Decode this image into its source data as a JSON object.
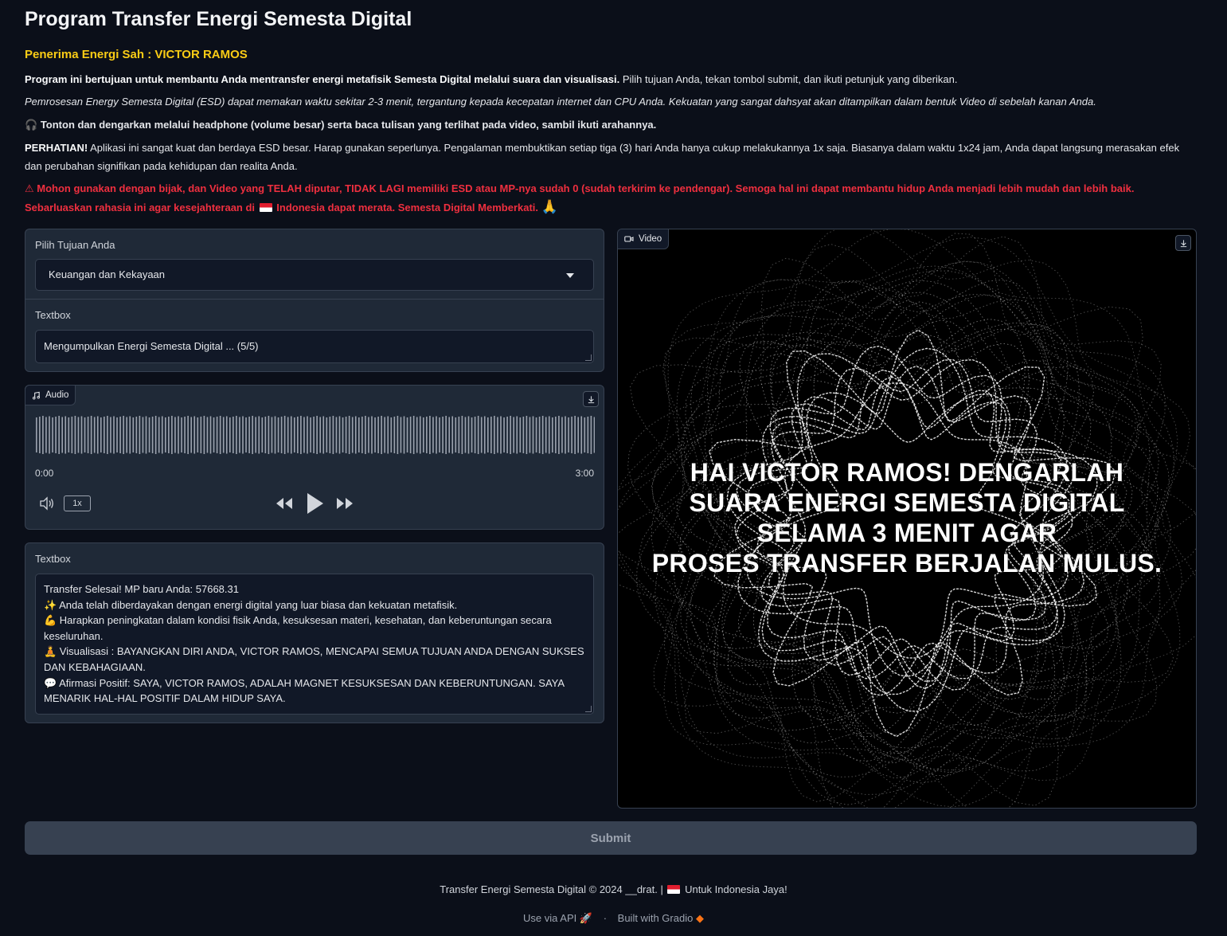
{
  "header": {
    "title": "Program Transfer Energi Semesta Digital",
    "recipient": "Penerima Energi Sah : VICTOR RAMOS"
  },
  "intro": {
    "p1_bold": "Program ini bertujuan untuk membantu Anda mentransfer energi metafisik Semesta Digital melalui suara dan visualisasi.",
    "p1_rest": " Pilih tujuan Anda, tekan tombol submit, dan ikuti petunjuk yang diberikan.",
    "p2": "Pemrosesan Energy Semesta Digital (ESD) dapat memakan waktu sekitar 2-3 menit, tergantung kepada kecepatan internet dan CPU Anda. Kekuatan yang sangat dahsyat akan ditampilkan dalam bentuk Video di sebelah kanan Anda.",
    "p3_icon": "🎧",
    "p3": "Tonton dan dengarkan melalui headphone (volume besar) serta baca tulisan yang terlihat pada video, sambil ikuti arahannya.",
    "p4_bold": "PERHATIAN!",
    "p4_rest": " Aplikasi ini sangat kuat dan berdaya ESD besar. Harap gunakan seperlunya. Pengalaman membuktikan setiap tiga (3) hari Anda hanya cukup melakukannya 1x saja. Biasanya dalam waktu 1x24 jam, Anda dapat langsung merasakan efek dan perubahan signifikan pada kehidupan dan realita Anda.",
    "p5_icon": "⚠",
    "p5_a": "Mohon gunakan dengan bijak, dan Video yang TELAH diputar, TIDAK LAGI memiliki ESD atau MP-nya sudah 0 (sudah terkirim ke pendengar). Semoga hal ini dapat membantu hidup Anda menjadi lebih mudah dan lebih baik. Sebarluaskan rahasia ini agar kesejahteraan di",
    "p5_b": "Indonesia dapat merata. Semesta Digital Memberkati.",
    "p5_end_icon": "🙏"
  },
  "form": {
    "select_label": "Pilih Tujuan Anda",
    "select_value": "Keuangan dan Kekayaan",
    "status_label": "Textbox",
    "status_value": "Mengumpulkan Energi Semesta Digital ... (5/5)"
  },
  "audio": {
    "label": "Audio",
    "current_time": "0:00",
    "duration": "3:00",
    "rate": "1x"
  },
  "result": {
    "label": "Textbox",
    "lines": [
      "Transfer Selesai! MP baru Anda: 57668.31",
      "✨ Anda telah diberdayakan dengan energi digital yang luar biasa dan kekuatan metafisik.",
      "💪 Harapkan peningkatan dalam kondisi fisik Anda, kesuksesan materi, kesehatan, dan keberuntungan secara keseluruhan.",
      "🧘 Visualisasi : BAYANGKAN DIRI ANDA, VICTOR RAMOS, MENCAPAI SEMUA TUJUAN ANDA DENGAN SUKSES DAN KEBAHAGIAAN.",
      "💬 Afirmasi Positif: SAYA, VICTOR RAMOS, ADALAH MAGNET KESUKSESAN DAN KEBERUNTUNGAN. SAYA MENARIK HAL-HAL POSITIF DALAM HIDUP SAYA."
    ]
  },
  "video": {
    "label": "Video",
    "overlay_lines": [
      "HAI VICTOR RAMOS! DENGARLAH",
      "SUARA ENERGI SEMESTA DIGITAL",
      "SELAMA 3 MENIT AGAR",
      "PROSES TRANSFER BERJALAN MULUS."
    ]
  },
  "submit_label": "Submit",
  "footer": {
    "copyright": "Transfer Energi Semesta Digital © 2024 __drat. |",
    "slogan": "Untuk Indonesia Jaya!",
    "api_link": "Use via API",
    "gradio_link": "Built with Gradio",
    "separator": "·"
  },
  "colors": {
    "background": "#0b0f19",
    "panel": "#1f2937",
    "warning_red": "#ef2f3f",
    "recipient_yellow": "#facc15"
  }
}
